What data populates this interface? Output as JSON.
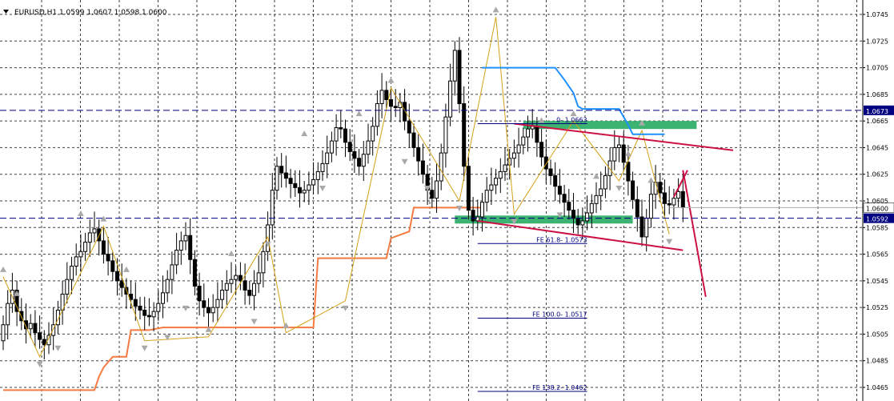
{
  "header": {
    "symbol_info": "EURUSD,H1  1.0599 1.0607 1.0598 1.0600"
  },
  "colors": {
    "background": "#ffffff",
    "grid": "#000000",
    "candle": "#000000",
    "hline": "#000080",
    "zigzag": "#d4a017",
    "orange_line": "#f47a42",
    "blue_line": "#1e90ff",
    "channel": "#cc1144",
    "zone": "#3cb371",
    "fractal": "#a9a9a9",
    "current_price_label": "#ffffff",
    "level_label": "#000080"
  },
  "chart_data": {
    "type": "candlestick",
    "title": "EURUSD,H1",
    "ohlc_header": "1.0599 1.0607 1.0598 1.0600",
    "ylim": [
      1.0465,
      1.0745
    ],
    "y_ticks": [
      "1.0745",
      "1.0725",
      "1.0705",
      "1.0685",
      "1.0665",
      "1.0645",
      "1.0625",
      "1.0605",
      "1.0585",
      "1.0565",
      "1.0545",
      "1.0525",
      "1.0505",
      "1.0485",
      "1.0465"
    ],
    "horizontal_levels": [
      {
        "price": 1.0673,
        "label": "1.0673",
        "style": "dashed"
      },
      {
        "price": 1.0592,
        "label": "1.0592",
        "style": "dashed"
      }
    ],
    "current_price": {
      "price": 1.06,
      "label": "1.0600"
    },
    "fibo_labels": [
      {
        "label": "0- 1.0663",
        "price": 1.0663
      },
      {
        "label": "FE 61.8- 1.0573",
        "price": 1.0573
      },
      {
        "label": "FE 100.0- 1.0517",
        "price": 1.0517
      },
      {
        "label": "FE 138.2- 1.0462",
        "price": 1.0462
      }
    ],
    "closes": [
      1.0512,
      1.0528,
      1.0538,
      1.0522,
      1.0515,
      1.0509,
      1.0513,
      1.0506,
      1.0501,
      1.0497,
      1.0504,
      1.0512,
      1.0523,
      1.0535,
      1.0546,
      1.0556,
      1.0563,
      1.0567,
      1.0574,
      1.0581,
      1.0584,
      1.0575,
      1.0565,
      1.056,
      1.0552,
      1.0545,
      1.054,
      1.0535,
      1.0531,
      1.0526,
      1.0523,
      1.0519,
      1.0518,
      1.0522,
      1.0528,
      1.0536,
      1.0546,
      1.0557,
      1.0568,
      1.0575,
      1.0579,
      1.0561,
      1.0541,
      1.053,
      1.0525,
      1.0521,
      1.0525,
      1.0531,
      1.0538,
      1.0543,
      1.0546,
      1.0549,
      1.0545,
      1.0538,
      1.0534,
      1.0543,
      1.0551,
      1.0567,
      1.0587,
      1.0613,
      1.0631,
      1.0626,
      1.0622,
      1.0618,
      1.0615,
      1.0611,
      1.0613,
      1.0617,
      1.0621,
      1.0627,
      1.0633,
      1.0641,
      1.065,
      1.066,
      1.0659,
      1.0649,
      1.0642,
      1.0637,
      1.0631,
      1.064,
      1.065,
      1.0661,
      1.0678,
      1.0688,
      1.0681,
      1.0676,
      1.0675,
      1.0679,
      1.0665,
      1.0656,
      1.0645,
      1.0635,
      1.0625,
      1.0613,
      1.0607,
      1.062,
      1.0641,
      1.0668,
      1.0695,
      1.0718,
      1.0678,
      1.0631,
      1.0598,
      1.059,
      1.0593,
      1.0604,
      1.0613,
      1.0617,
      1.0622,
      1.0627,
      1.0632,
      1.0637,
      1.0641,
      1.0647,
      1.0653,
      1.0659,
      1.0661,
      1.0649,
      1.0638,
      1.0629,
      1.0624,
      1.0616,
      1.061,
      1.0604,
      1.0598,
      1.0592,
      1.0587,
      1.059,
      1.0596,
      1.0603,
      1.0609,
      1.0614,
      1.0624,
      1.0635,
      1.0645,
      1.0647,
      1.0634,
      1.062,
      1.0606,
      1.0593,
      1.0578,
      1.0592,
      1.061,
      1.0619,
      1.0611,
      1.0603,
      1.0602,
      1.0607,
      1.0612,
      1.06
    ],
    "series": [
      {
        "name": "ZigZag",
        "points": [
          [
            0,
            1.0548
          ],
          [
            8,
            1.0488
          ],
          [
            22,
            1.0586
          ],
          [
            31,
            1.05
          ],
          [
            45,
            1.0503
          ],
          [
            58,
            1.0578
          ],
          [
            62,
            1.0506
          ],
          [
            75,
            1.053
          ],
          [
            85,
            1.069
          ],
          [
            100,
            1.0605
          ],
          [
            108,
            1.0743
          ],
          [
            112,
            1.0595
          ],
          [
            125,
            1.0665
          ],
          [
            135,
            1.062
          ],
          [
            140,
            1.0658
          ],
          [
            146,
            1.058
          ]
        ]
      }
    ]
  }
}
